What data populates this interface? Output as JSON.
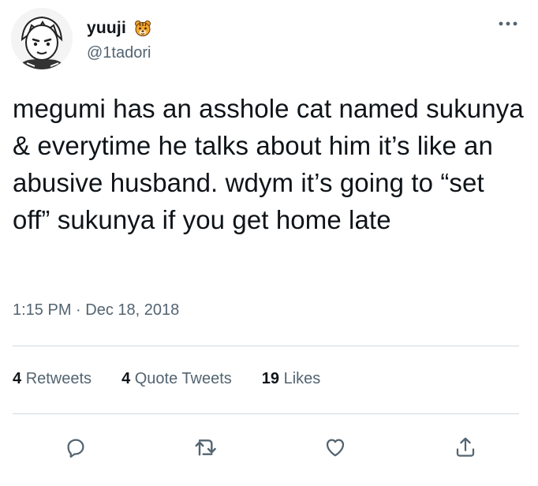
{
  "author": {
    "display_name": "yuuji",
    "emoji_icon": "tiger-face-icon",
    "handle": "@1tadori"
  },
  "tweet": {
    "text": "megumi has an asshole cat named sukunya & everytime he talks about him it’s like an abusive husband. wdym it’s going to “set off” sukunya if you get home late",
    "time": "1:15 PM",
    "separator": "·",
    "date": "Dec 18, 2018"
  },
  "stats": {
    "retweets": {
      "count": "4",
      "label": "Retweets"
    },
    "quote_tweets": {
      "count": "4",
      "label": "Quote Tweets"
    },
    "likes": {
      "count": "19",
      "label": "Likes"
    }
  },
  "actions": [
    {
      "name": "reply-icon"
    },
    {
      "name": "retweet-icon"
    },
    {
      "name": "like-icon"
    },
    {
      "name": "share-icon"
    }
  ],
  "colors": {
    "text": "#0f1419",
    "secondary": "#536471",
    "divider": "#cfd9de"
  }
}
